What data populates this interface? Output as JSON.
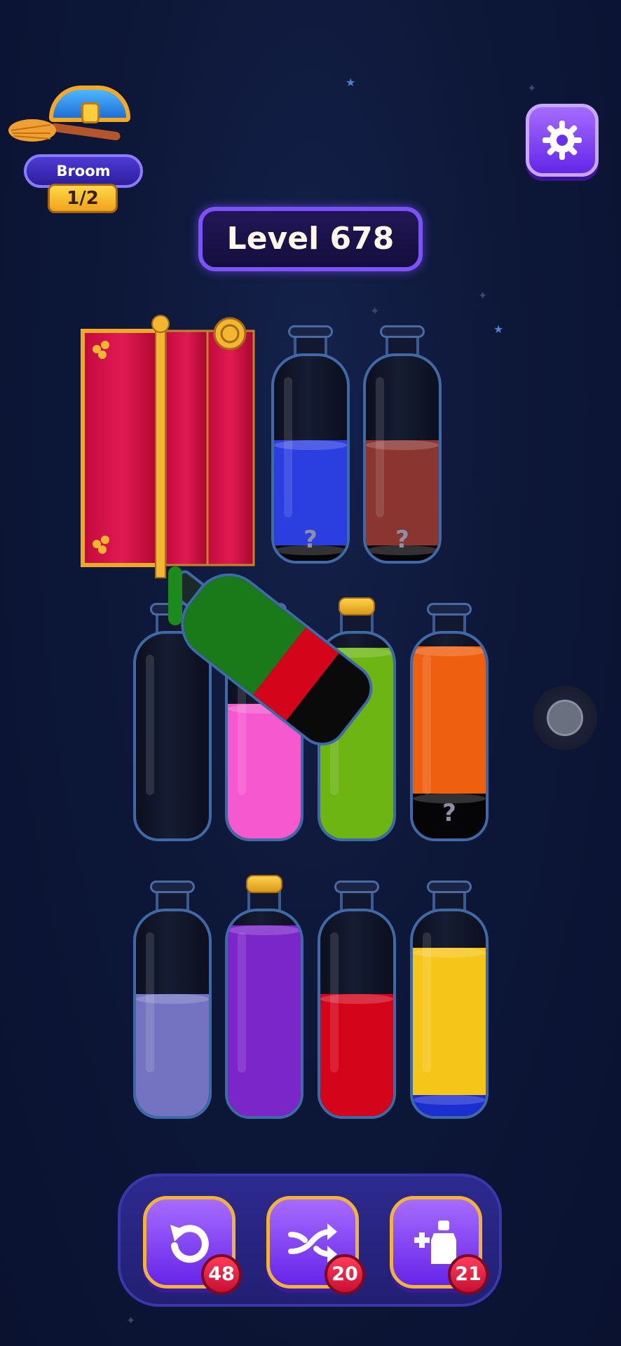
{
  "streak": {
    "title": "Broom Streak",
    "count": "1/2"
  },
  "level": {
    "label": "Level 678"
  },
  "hidden_mark": "?",
  "bottles": [
    {
      "id": "b1",
      "layers": [
        "blue",
        "hidden"
      ]
    },
    {
      "id": "b2",
      "layers": [
        "brown",
        "hidden"
      ]
    },
    {
      "id": "b3",
      "layers": []
    },
    {
      "id": "b4",
      "layers": [
        "pink"
      ]
    },
    {
      "id": "b5",
      "layers": [
        "lime"
      ],
      "capped": true
    },
    {
      "id": "b6",
      "layers": [
        "orange",
        "hidden"
      ]
    },
    {
      "id": "b7",
      "layers": [
        "lavender"
      ]
    },
    {
      "id": "b8",
      "layers": [
        "purple"
      ],
      "capped": true
    },
    {
      "id": "b9",
      "layers": [
        "red"
      ]
    },
    {
      "id": "b10",
      "layers": [
        "yellow",
        "navy"
      ]
    },
    {
      "id": "pouring",
      "layers": [
        "green",
        "red",
        "black"
      ]
    }
  ],
  "powerups": [
    {
      "name": "undo",
      "icon": "undo-icon",
      "count": "48"
    },
    {
      "name": "shuffle",
      "icon": "shuffle-icon",
      "count": "20"
    },
    {
      "name": "add-bottle",
      "icon": "add-bottle-icon",
      "count": "21"
    }
  ],
  "colors": {
    "blue": "#2b3ee0",
    "brown": "#8a3530",
    "pink": "#f558cf",
    "lime": "#6db512",
    "orange": "#ee5f0f",
    "lavender": "#7373c2",
    "purple": "#7a26c9",
    "red": "#d4051a",
    "yellow": "#f6c51a",
    "navy": "#1c2ed0",
    "green": "#1a7a1a",
    "black": "#0a0a0a",
    "accent": "#7c52ff",
    "gold": "#f2b33a"
  }
}
